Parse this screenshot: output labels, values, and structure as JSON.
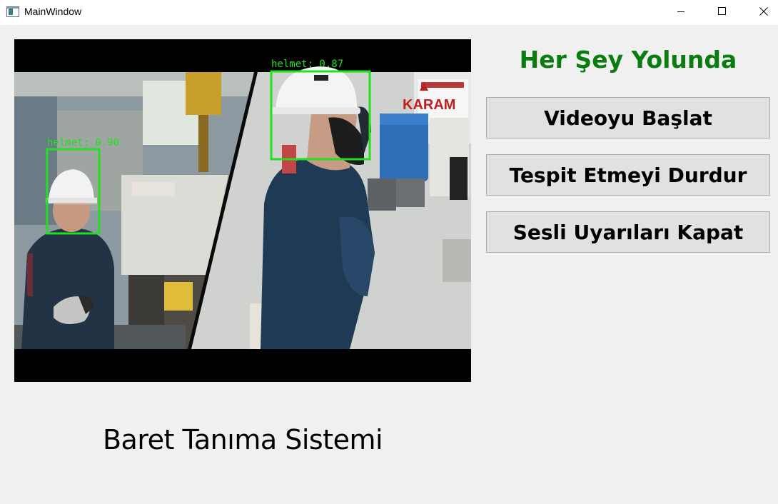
{
  "window": {
    "title": "MainWindow",
    "controls": [
      "minimize",
      "maximize",
      "close"
    ]
  },
  "video": {
    "detections": [
      {
        "label": "helmet: 0.90"
      },
      {
        "label": "helmet: 0.87"
      }
    ],
    "scene_text": {
      "brand": "KARAM"
    },
    "box_color": "#22e01f"
  },
  "status": {
    "text": "Her Şey Yolunda",
    "color": "#0b7d10"
  },
  "buttons": {
    "start_video": "Videoyu Başlat",
    "stop_detection": "Tespit Etmeyi Durdur",
    "mute_alerts": "Sesli Uyarıları Kapat"
  },
  "footer": {
    "title": "Baret Tanıma Sistemi"
  }
}
